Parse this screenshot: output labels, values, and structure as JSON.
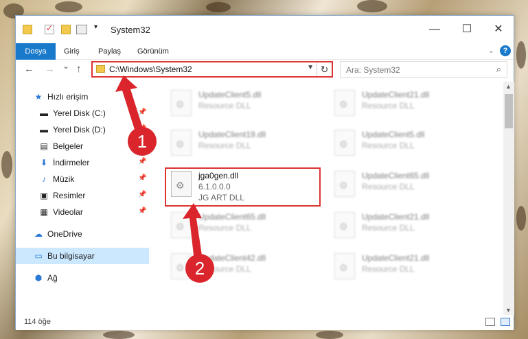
{
  "window": {
    "title": "System32",
    "controls": {
      "minimize": "—",
      "maximize": "☐",
      "close": "✕"
    }
  },
  "ribbon": {
    "tabs": [
      "Dosya",
      "Giriş",
      "Paylaş",
      "Görünüm"
    ],
    "help": "?"
  },
  "nav": {
    "back": "←",
    "forward": "→",
    "recent": "⌄",
    "up": "↑",
    "address": "C:\\Windows\\System32",
    "search_placeholder": "Ara: System32"
  },
  "sidebar": {
    "items": [
      {
        "label": "Hızlı erişim",
        "icon": "star-icon",
        "pinned": false
      },
      {
        "label": "Yerel Disk (C:)",
        "icon": "drive-icon",
        "pinned": true
      },
      {
        "label": "Yerel Disk (D:)",
        "icon": "drive-icon",
        "pinned": true
      },
      {
        "label": "Belgeler",
        "icon": "documents-icon",
        "pinned": true
      },
      {
        "label": "İndirmeler",
        "icon": "downloads-icon",
        "pinned": true
      },
      {
        "label": "Müzik",
        "icon": "music-icon",
        "pinned": true
      },
      {
        "label": "Resimler",
        "icon": "pictures-icon",
        "pinned": true
      },
      {
        "label": "Videolar",
        "icon": "videos-icon",
        "pinned": true
      },
      {
        "label": "OneDrive",
        "icon": "cloud-icon",
        "pinned": false
      },
      {
        "label": "Bu bilgisayar",
        "icon": "computer-icon",
        "pinned": false,
        "selected": true
      },
      {
        "label": "Ağ",
        "icon": "network-icon",
        "pinned": false
      }
    ]
  },
  "files": [
    {
      "name": "UpdateClient5.dll",
      "line2": "Resource DLL",
      "line3": ""
    },
    {
      "name": "UpdateClient21.dll",
      "line2": "Resource DLL",
      "line3": ""
    },
    {
      "name": "UpdateClient19.dll",
      "line2": "Resource DLL",
      "line3": ""
    },
    {
      "name": "UpdateClient5.dll",
      "line2": "Resource DLL",
      "line3": ""
    },
    {
      "name": "jga0gen.dll",
      "line2": "6.1.0.0.0",
      "line3": "JG ART DLL",
      "highlighted": true
    },
    {
      "name": "UpdateClient65.dll",
      "line2": "Resource DLL",
      "line3": ""
    },
    {
      "name": "UpdateClient65.dll",
      "line2": "Resource DLL",
      "line3": ""
    },
    {
      "name": "UpdateClient21.dll",
      "line2": "Resource DLL",
      "line3": ""
    },
    {
      "name": "UpdateClient42.dll",
      "line2": "Resource DLL",
      "line3": ""
    },
    {
      "name": "UpdateClient21.dll",
      "line2": "Resource DLL",
      "line3": ""
    }
  ],
  "status": {
    "count": "114 öğe"
  },
  "annotations": {
    "step1": "1",
    "step2": "2",
    "color": "#d9252b"
  }
}
